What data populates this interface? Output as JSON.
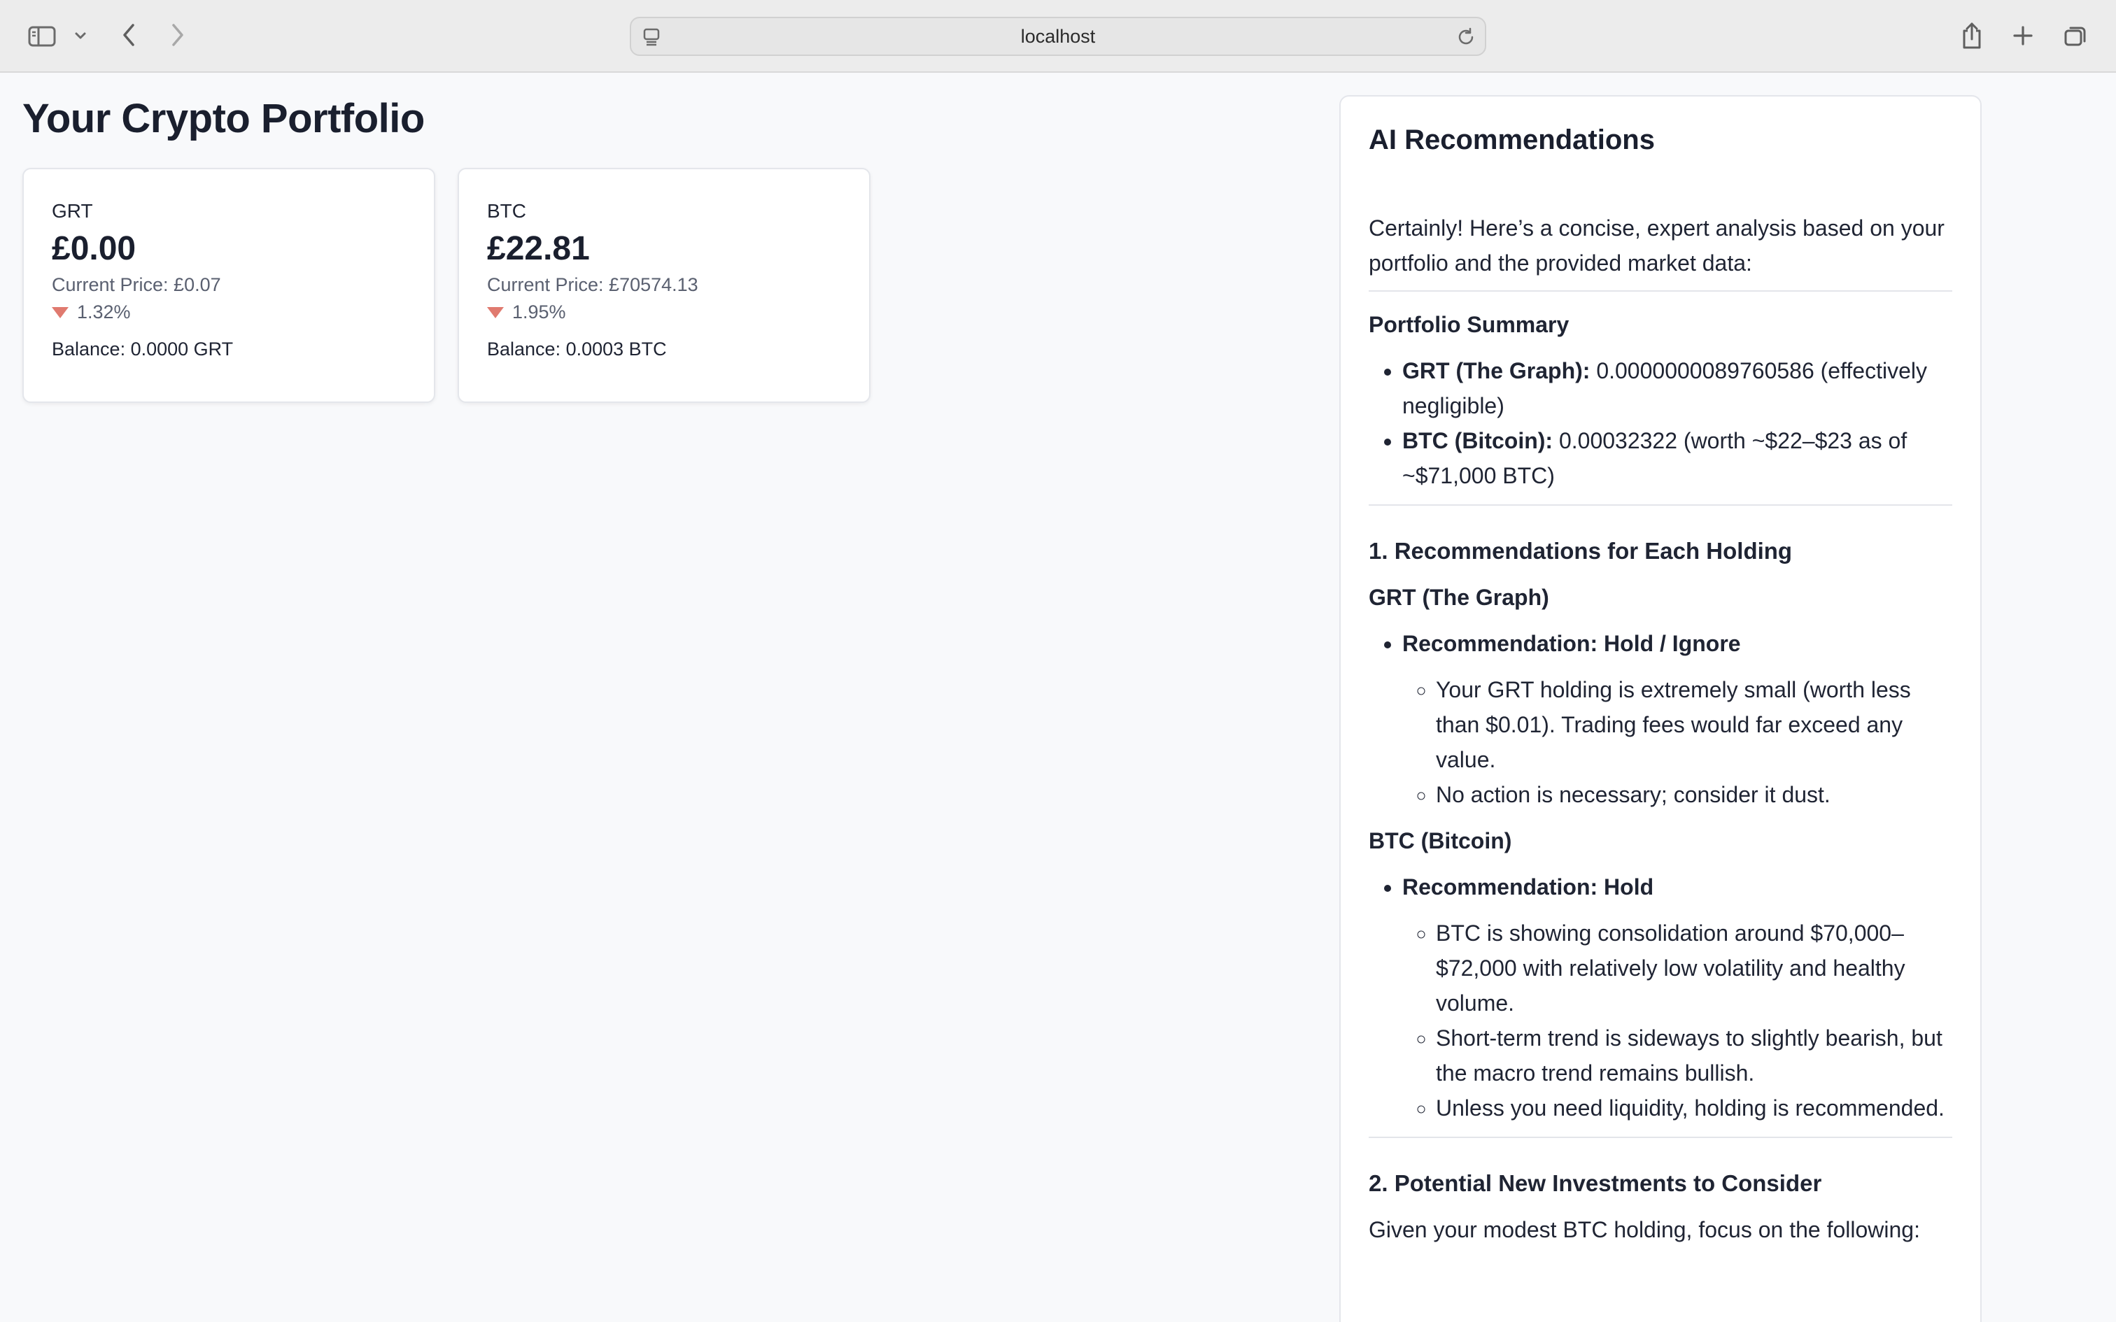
{
  "browser": {
    "url": "localhost"
  },
  "page": {
    "title": "Your Crypto Portfolio"
  },
  "cards": [
    {
      "symbol": "GRT",
      "value": "£0.00",
      "current_price": "Current Price: £0.07",
      "change": "1.32%",
      "change_direction": "down",
      "balance": "Balance: 0.0000 GRT"
    },
    {
      "symbol": "BTC",
      "value": "£22.81",
      "current_price": "Current Price: £70574.13",
      "change": "1.95%",
      "change_direction": "down",
      "balance": "Balance: 0.0003 BTC"
    }
  ],
  "ai": {
    "title": "AI Recommendations",
    "intro": "Certainly! Here’s a concise, expert analysis based on your portfolio and the provided market data:",
    "summary_heading": "Portfolio Summary",
    "summary_items": [
      {
        "label": "GRT (The Graph):",
        "text": " 0.0000000089760586 (effectively negligible)"
      },
      {
        "label": "BTC (Bitcoin):",
        "text": " 0.00032322 (worth ~$22–$23 as of ~$71,000 BTC)"
      }
    ],
    "section1_heading": "1. Recommendations for Each Holding",
    "grt": {
      "heading": "GRT (The Graph)",
      "recommendation": "Recommendation: Hold / Ignore",
      "points": [
        "Your GRT holding is extremely small (worth less than $0.01). Trading fees would far exceed any value.",
        "No action is necessary; consider it dust."
      ]
    },
    "btc": {
      "heading": "BTC (Bitcoin)",
      "recommendation": "Recommendation: Hold",
      "points": [
        "BTC is showing consolidation around $70,000–$72,000 with relatively low volatility and healthy volume.",
        "Short-term trend is sideways to slightly bearish, but the macro trend remains bullish.",
        "Unless you need liquidity, holding is recommended."
      ]
    },
    "section2_heading": "2. Potential New Investments to Consider",
    "section2_intro": "Given your modest BTC holding, focus on the following:"
  },
  "colors": {
    "negative": "#e07a6f",
    "toolbar_bg": "#ececec",
    "page_bg": "#f8f9fb"
  }
}
